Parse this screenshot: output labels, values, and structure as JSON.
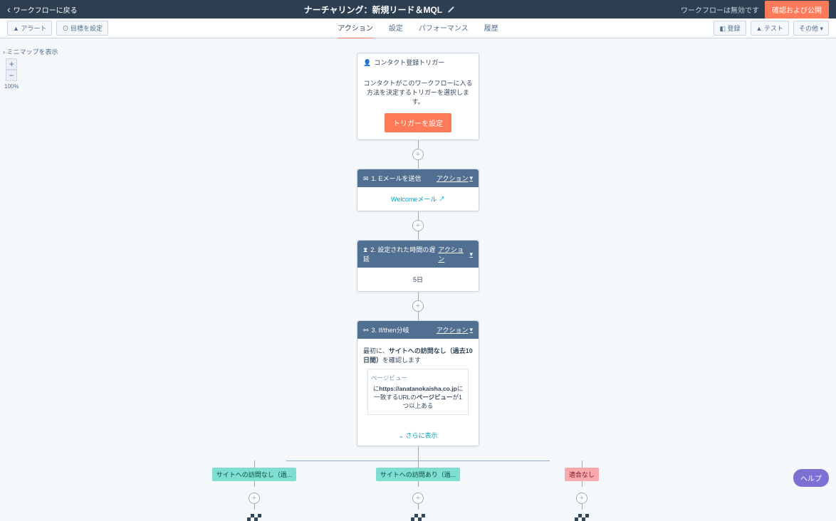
{
  "topbar": {
    "back": "ワークフローに戻る",
    "title": "ナーチャリング：新規リード＆MQL",
    "status": "ワークフローは無効です",
    "publish": "確認および公開"
  },
  "subnav": {
    "alerts": "アラート",
    "goals": "目標を設定",
    "tabs": {
      "actions": "アクション",
      "settings": "設定",
      "performance": "パフォーマンス",
      "history": "履歴"
    },
    "enroll": "登録",
    "test": "テスト",
    "more": "その他"
  },
  "canvas": {
    "minimap": "ミニマップを表示",
    "zoom_pct": "100%"
  },
  "trigger": {
    "title": "コンタクト登録トリガー",
    "desc": "コンタクトがこのワークフローに入る方法を決定するトリガーを選択します。",
    "cta": "トリガーを設定"
  },
  "action1": {
    "title": "1. Eメールを送信",
    "actions_label": "アクション",
    "link": "Welcomeメール"
  },
  "action2": {
    "title": "2. 設定された時間の遅延",
    "actions_label": "アクション",
    "body": "5日"
  },
  "action3": {
    "title": "3. If/then分岐",
    "actions_label": "アクション",
    "body_pre": "最初に、",
    "body_bold": "サイトへの訪問なし（過去10日間）",
    "body_post": "を確認します",
    "box_label": "ページビュー",
    "box_body_pre": "に",
    "box_body_bold1": "https://anatanokaisha.co.jp",
    "box_body_mid": "に一致するURLの",
    "box_body_bold2": "ページビュー",
    "box_body_post": "が1つ以上ある",
    "show_more": "さらに表示"
  },
  "branches": {
    "b1": "サイトへの訪問なし（過...",
    "b2": "サイトへの訪問あり（過...",
    "b3": "適合なし"
  },
  "help": "ヘルプ"
}
